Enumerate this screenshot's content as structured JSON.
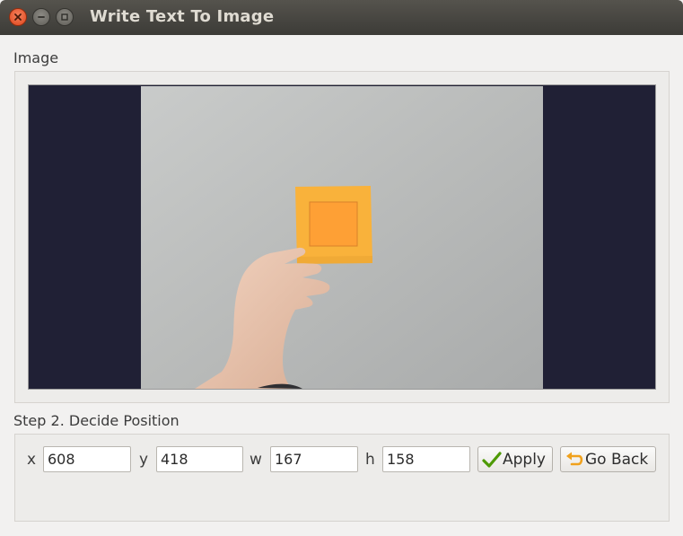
{
  "window": {
    "title": "Write Text To Image"
  },
  "image_section": {
    "label": "Image"
  },
  "step": {
    "label": "Step 2. Decide Position",
    "fields": {
      "x": {
        "label": "x",
        "value": "608"
      },
      "y": {
        "label": "y",
        "value": "418"
      },
      "w": {
        "label": "w",
        "value": "167"
      },
      "h": {
        "label": "h",
        "value": "158"
      }
    },
    "apply_label": "Apply",
    "go_back_label": "Go Back"
  },
  "icons": {
    "close": "close-icon",
    "minimize": "minimize-icon",
    "maximize": "maximize-icon",
    "apply": "checkmark-icon",
    "go_back": "undo-arrow-icon"
  },
  "colors": {
    "titlebar": "#3c3b37",
    "close_button": "#e0451b",
    "image_background": "#202035",
    "highlight_rect": "#ff9933"
  }
}
